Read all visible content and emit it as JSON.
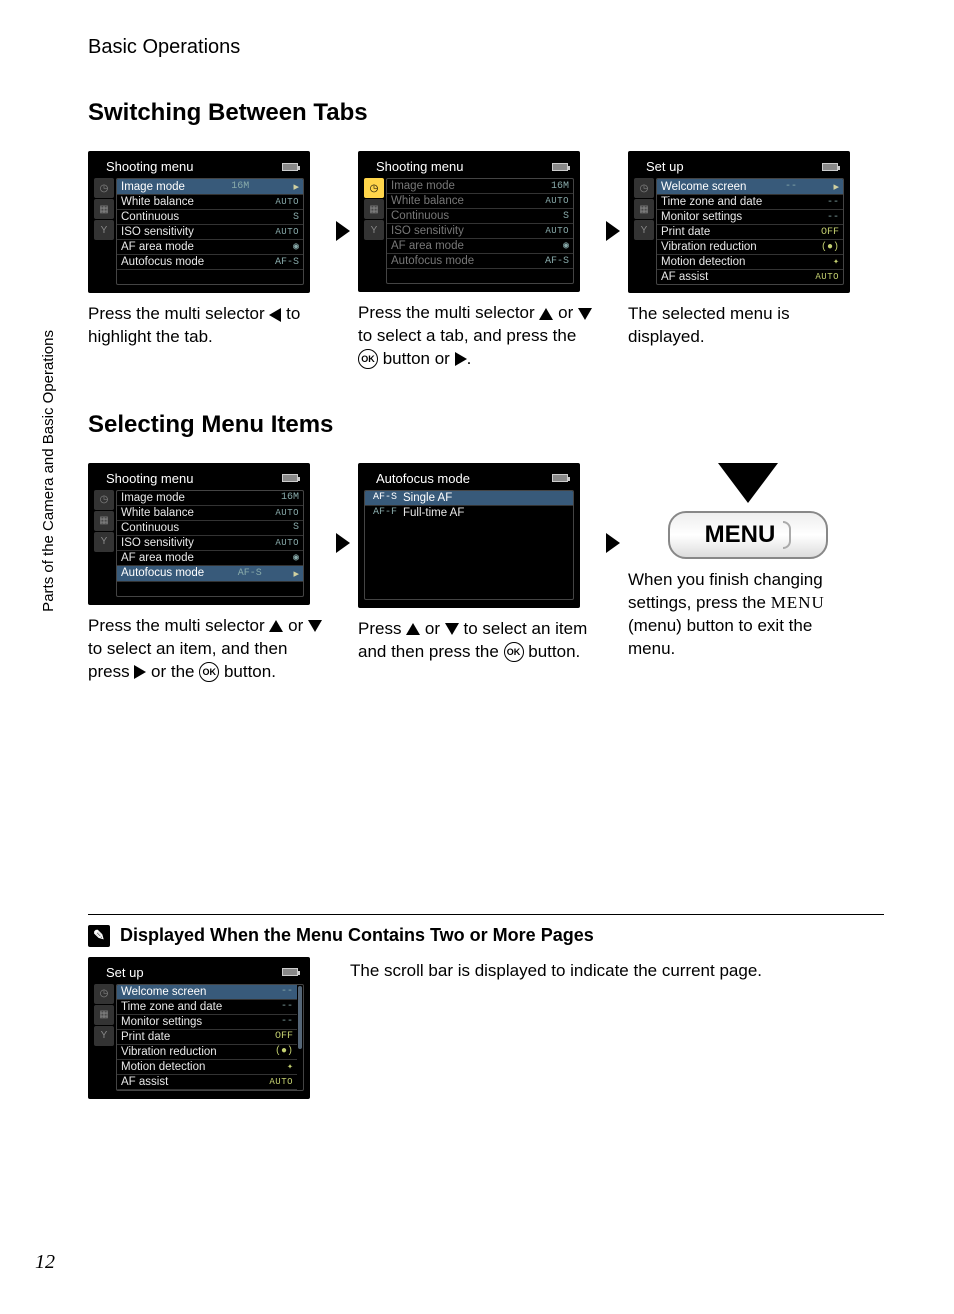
{
  "sidebar_label": "Parts of the Camera and Basic Operations",
  "header": "Basic Operations",
  "section1_title": "Switching Between Tabs",
  "section2_title": "Selecting Menu Items",
  "page_number": "12",
  "menu_titles": {
    "shooting": "Shooting menu",
    "setup": "Set up",
    "autofocus": "Autofocus mode"
  },
  "shooting_items": [
    {
      "label": "Image mode",
      "val": "16M"
    },
    {
      "label": "White balance",
      "val": "AUTO"
    },
    {
      "label": "Continuous",
      "val": "S"
    },
    {
      "label": "ISO sensitivity",
      "val": "AUTO"
    },
    {
      "label": "AF area mode",
      "val": "◉"
    },
    {
      "label": "Autofocus mode",
      "val": "AF-S"
    }
  ],
  "setup_items": [
    {
      "label": "Welcome screen",
      "val": "--"
    },
    {
      "label": "Time zone and date",
      "val": "--"
    },
    {
      "label": "Monitor settings",
      "val": "--"
    },
    {
      "label": "Print date",
      "val": "OFF"
    },
    {
      "label": "Vibration reduction",
      "val": "(●)"
    },
    {
      "label": "Motion detection",
      "val": "✦"
    },
    {
      "label": "AF assist",
      "val": "AUTO"
    }
  ],
  "af_items": [
    {
      "code": "AF-S",
      "label": "Single AF"
    },
    {
      "code": "AF-F",
      "label": "Full-time AF"
    }
  ],
  "captions": {
    "s1c1a": "Press the multi selector ",
    "s1c1b": " to highlight the tab.",
    "s1c2a": "Press the multi selector ",
    "s1c2b": " or ",
    "s1c2c": " to select a tab, and press the ",
    "s1c2d": " button or ",
    "s1c2e": ".",
    "s1c3": "The selected menu is displayed.",
    "s2c1a": "Press the multi selector ",
    "s2c1b": " or ",
    "s2c1c": " to select an item, and then press ",
    "s2c1d": " or the ",
    "s2c1e": " button.",
    "s2c2a": "Press ",
    "s2c2b": " or ",
    "s2c2c": " to select an item and then press the ",
    "s2c2d": " button.",
    "s2c3a": "When you finish changing settings, press the ",
    "s2c3b": " (menu) button to exit the menu."
  },
  "menu_word": "MENU",
  "menu_word_ui": "MENU",
  "note_title": "Displayed When the Menu Contains Two or More Pages",
  "note_text": "The scroll bar is displayed to indicate the current page."
}
